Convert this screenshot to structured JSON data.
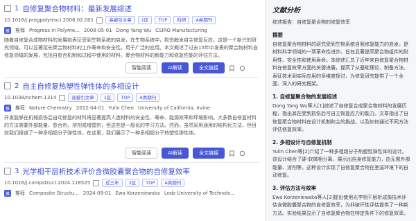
{
  "papers": [
    {
      "title": "自修复聚合物材料：最新发展综述",
      "doi": "10.1016/j.progpolymsci.2008.02.001",
      "tags": [
        "高被引文章",
        "1区",
        "TOP",
        "科研",
        "A类期刊"
      ],
      "source_badge": "推",
      "source_label": "推荐",
      "journal": "Progress in Polyme...",
      "date": "2008-05-01",
      "author": "Dong Yang Wu",
      "affiliation": "CSIRO Manufacturing",
      "abstract": "随着自修复合成物材料的发展和表征受到生物系统的启发，在生物系统中，损伤触发自主修复反应。这是一个新兴的研究领域，可以显著延长聚合物材料的工作寿命和安全性。用于广泛的应用。本文概述了过去15年中发表的聚合物材料自修复领域的发展，包括自愈合机制和过程中使用的材料。聚合物材料的新能力和修复性能的评估方法。",
      "buttons": {
        "notes": "智能阅读",
        "ai": "AI解读",
        "fulltext": "全文链接"
      }
    },
    {
      "title": "自主自修复热塑性弹性体的多相设计",
      "doi": "10.1038/nchem.1314",
      "tags": [
        "高被引文章",
        "1区",
        "TOP",
        "A类期刊"
      ],
      "source_badge": "推",
      "source_label": "推荐",
      "journal": "Nature Chemistry",
      "date": "2012-04-01",
      "author": "Yulin Chen",
      "affiliation": "University of California, Irvine",
      "abstract": "开发能够在机械损伤后自动修复的材料将显著提高人造材料的安全性、寿命、能源效率和环境影响。大多数自修复材料的方法需要外部能量、愈合剂、溶剂或增塑剂，但这些是一般化的学习方法。然而，虽然采用通用的结构化方法，但目前我们报道了一种多相超分子弹性体，在这里，我们展示了一种多相超分子热塑性弹性体。",
      "buttons": {
        "notes": "智能阅读",
        "ai": "AI解读",
        "fulltext": "全文链接"
      }
    },
    {
      "title": "光学相干层析技术评价含微胶囊聚合物的自修复效率",
      "doi": "10.1016/j.compstruct.2024.118525",
      "tags": [
        "近三年",
        "2区",
        "TOP",
        "A类期刊"
      ],
      "source_badge": "推",
      "source_label": "推荐",
      "journal": "Composite Structu...",
      "date": "2024-09-01",
      "author": "Ewa Korzeniewska",
      "affiliation": "Lodz University of Technolo...",
      "abstract": "",
      "buttons": {
        "notes": "",
        "ai": "",
        "fulltext": ""
      }
    }
  ],
  "analysis": {
    "title": "文献分析",
    "summary_label": "综述报告：自修复聚合物的修复效率",
    "abstract_head": "摘要",
    "abstract_text": "自修复聚合物材料的研究受到生物系统自我修复能力的启发，是材料科学领域的一项革命性进步。旨在显著提高聚合物组件的耐用性、安全性和使用寿命。本综述汇总了近年来自修复聚合物材料在修复效率方面的关键进展，提高了从基础理论、制备方法、表征技术到实际应用的多维度探讨，为修复研究提供了一个全面、深入的研究框架。",
    "section1_head": "1. 自修复聚合物的发展综述",
    "section1_text": "Dong Yang Wu等人[1]综述了自修复合成聚合物材料的发展历程，指出其在受到损伤后可自主恢复应力的能力。文章指出了自修复聚合物材料在设计机制和主的挑战，以及如何通过不同方法评估修复效率。",
    "section2_head": "2. 多相设计与自修复机制",
    "section2_text": "Yulin Chen等[2]介绍了一种多相超分子热塑性弹性体的设计。该设计结合了硬-软微相分离，展示出自身修复能力，由无需外部能量、溶剂等。这种设计实现了自修复聚合物在室温环境下的自动修复。",
    "section3_head": "3. 评估方法与效率",
    "section3_text": "Ewa Korzeniewska等人[3]提出使用光学相干层析成像技术评估含微胶囊聚合物的自修复效率，为非破坏性评估提供了一种新方法。实验结果显示了自修复聚合物在特定条件下的修复效率。"
  }
}
